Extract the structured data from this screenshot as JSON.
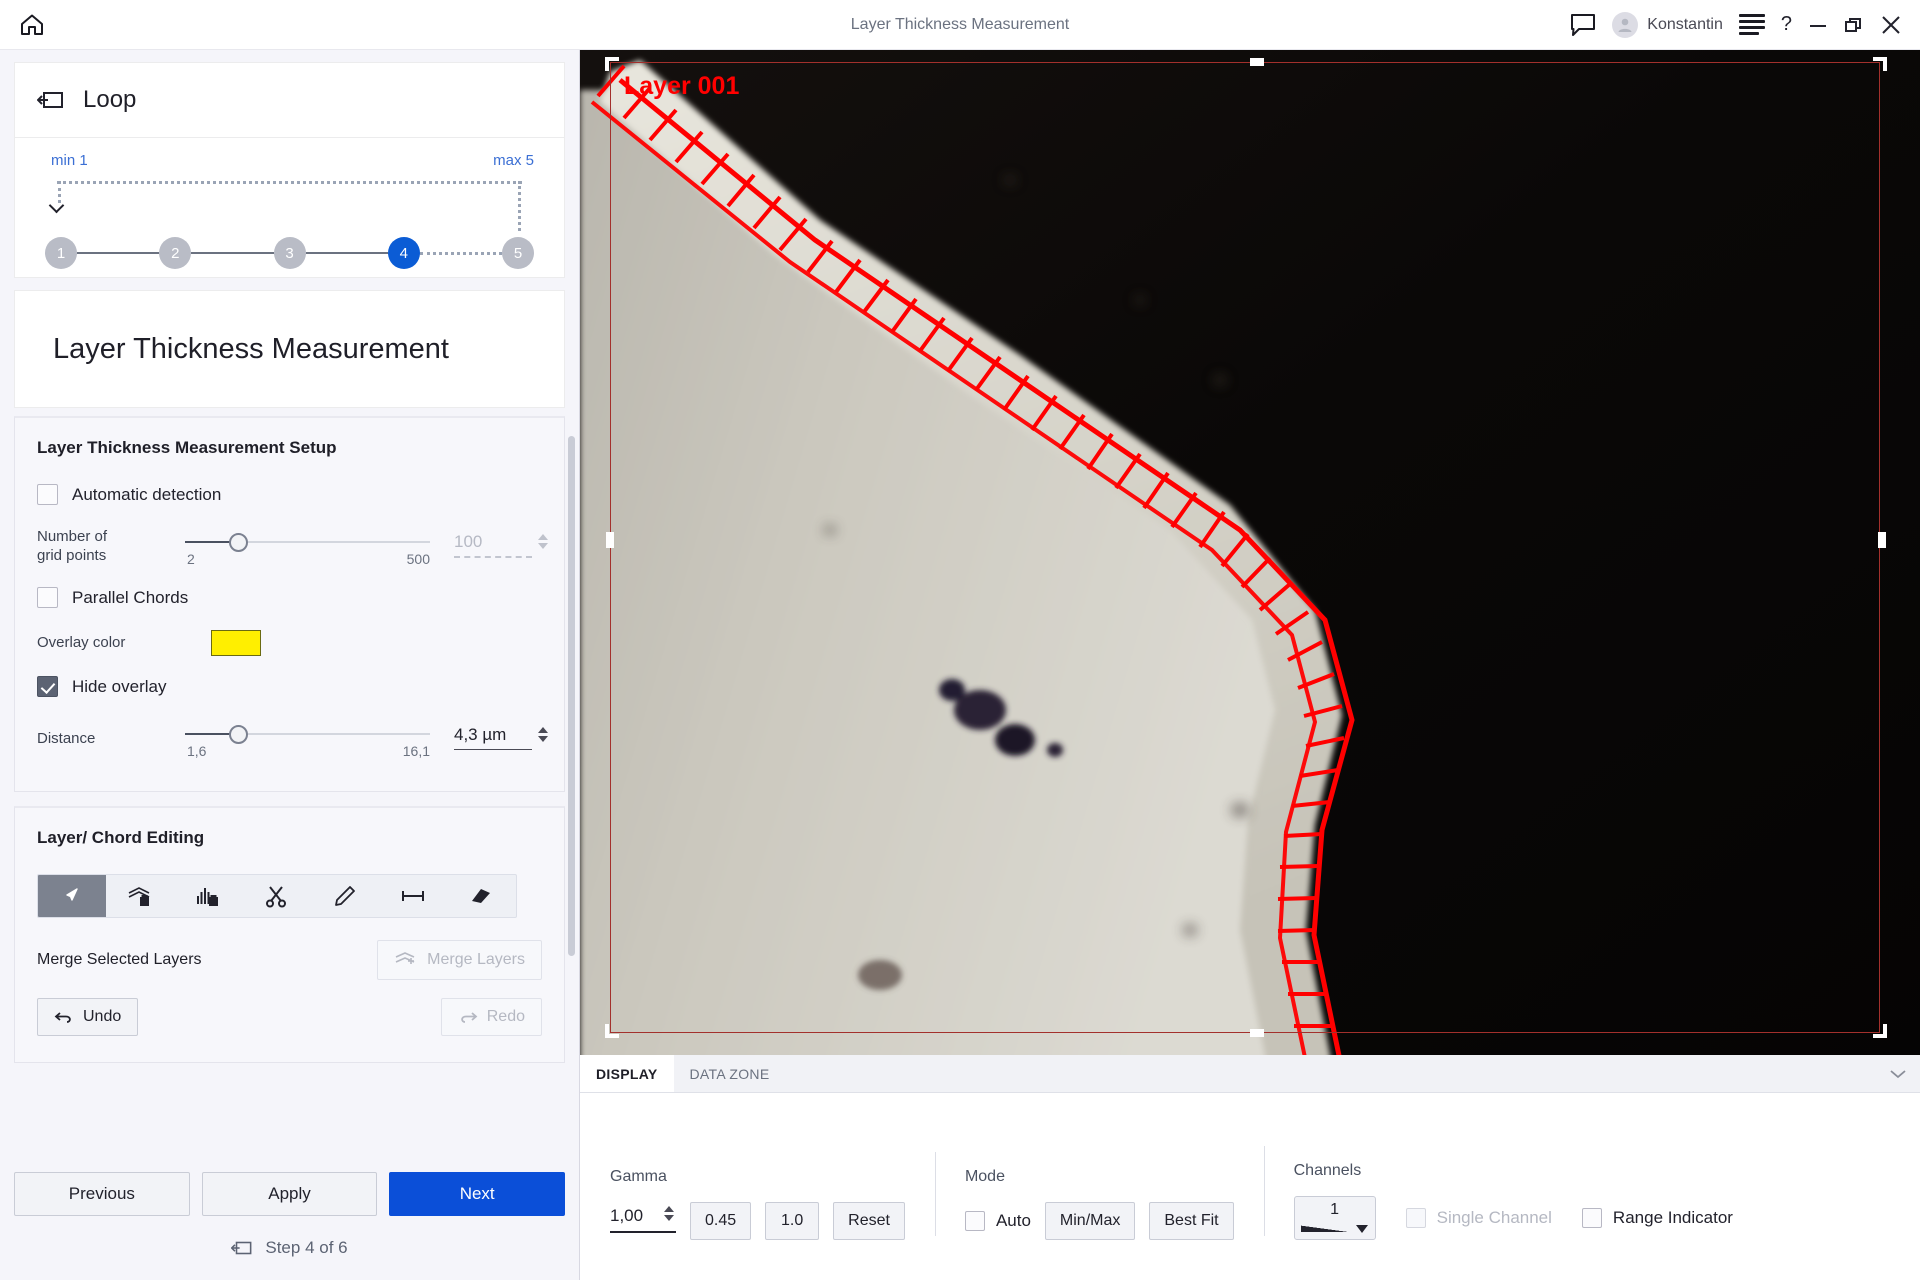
{
  "titlebar": {
    "home_icon": "home-icon",
    "title": "Layer Thickness Measurement",
    "chat_icon": "chat-bubble-icon",
    "user_name": "Konstantin",
    "menu_icon": "hamburger-menu-icon",
    "help_label": "?",
    "minimize_label": "minimize-icon",
    "restore_label": "restore-icon",
    "close_label": "close-icon"
  },
  "loop": {
    "icon": "loop-icon",
    "label": "Loop",
    "min_label": "min 1",
    "max_label": "max 5",
    "steps": [
      "1",
      "2",
      "3",
      "4",
      "5"
    ],
    "active_index": 3
  },
  "panel": {
    "heading": "Layer Thickness Measurement"
  },
  "setup": {
    "title": "Layer Thickness Measurement Setup",
    "automatic_detection": {
      "label": "Automatic detection",
      "checked": false
    },
    "grid_points": {
      "label_line1": "Number of",
      "label_line2": "grid points",
      "min": "2",
      "max": "500",
      "value": "100",
      "disabled": true
    },
    "parallel_chords": {
      "label": "Parallel Chords",
      "checked": false
    },
    "overlay_color": {
      "label": "Overlay color",
      "color": "#ffef00"
    },
    "hide_overlay": {
      "label": "Hide overlay",
      "checked": true
    },
    "distance": {
      "label": "Distance",
      "min": "1,6",
      "max": "16,1",
      "value": "4,3 µm"
    }
  },
  "editing": {
    "title": "Layer/ Chord Editing",
    "tools": [
      {
        "name": "cursor-select-tool",
        "selected": true
      },
      {
        "name": "delete-layer-tool",
        "selected": false
      },
      {
        "name": "delete-chord-tool",
        "selected": false
      },
      {
        "name": "cut-scissors-tool",
        "selected": false
      },
      {
        "name": "draw-pencil-tool",
        "selected": false
      },
      {
        "name": "measure-distance-tool",
        "selected": false
      },
      {
        "name": "eraser-tool",
        "selected": false
      }
    ],
    "merge_label": "Merge Selected Layers",
    "merge_button": "Merge Layers",
    "merge_disabled": true,
    "undo_button": "Undo",
    "undo_disabled": false,
    "redo_button": "Redo",
    "redo_disabled": true
  },
  "footer": {
    "previous": "Previous",
    "apply": "Apply",
    "next": "Next",
    "step_text": "Step 4 of 6",
    "step_icon": "loop-icon"
  },
  "viewer": {
    "layer_label": "Layer 001",
    "overlay_color": "#ff0000",
    "roi_border_color": "#a3302c"
  },
  "dock": {
    "tabs": [
      {
        "label": "DISPLAY",
        "active": true
      },
      {
        "label": "DATA ZONE",
        "active": false
      }
    ],
    "collapse_icon": "chevron-down-icon",
    "gamma": {
      "label": "Gamma",
      "value": "1,00",
      "preset_1": "0.45",
      "preset_2": "1.0",
      "reset": "Reset"
    },
    "mode": {
      "label": "Mode",
      "auto": {
        "label": "Auto",
        "checked": false
      },
      "minmax": "Min/Max",
      "bestfit": "Best Fit"
    },
    "channels": {
      "label": "Channels",
      "value": "1",
      "single_channel": {
        "label": "Single Channel",
        "checked": false,
        "disabled": true
      },
      "range_indicator": {
        "label": "Range Indicator",
        "checked": false,
        "disabled": false
      }
    }
  }
}
